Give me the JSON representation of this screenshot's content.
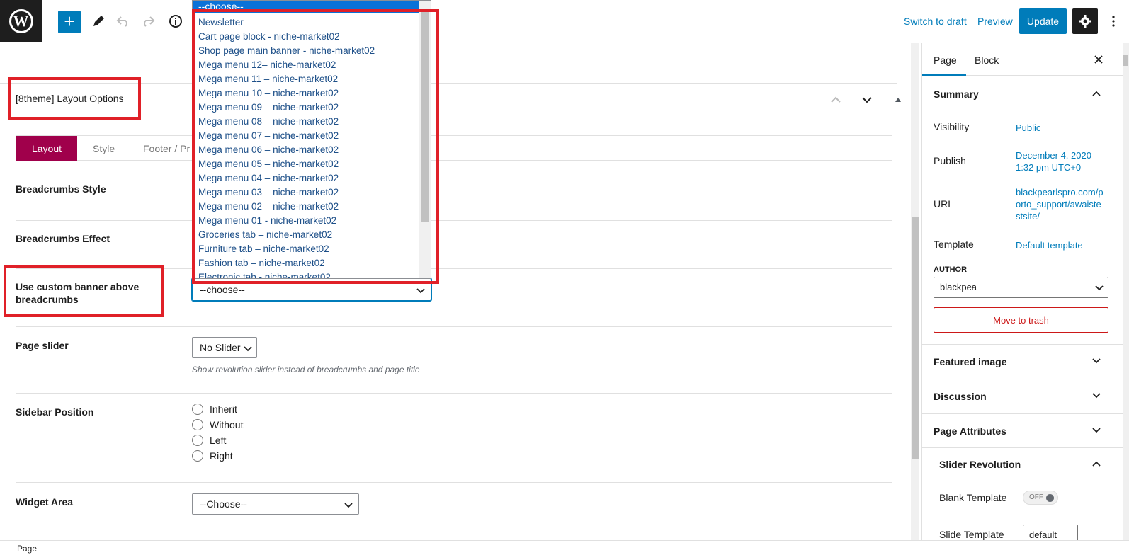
{
  "toolbar": {
    "switch_to_draft": "Switch to draft",
    "preview": "Preview",
    "update": "Update",
    "add_symbol": "+"
  },
  "metabox": {
    "title": "[8theme] Layout Options",
    "tabs": [
      "Layout",
      "Style",
      "Footer / Pr"
    ],
    "rows": {
      "breadcrumbs_style": "Breadcrumbs Style",
      "breadcrumbs_effect": "Breadcrumbs Effect",
      "custom_banner": "Use custom banner above breadcrumbs",
      "page_slider": "Page slider",
      "sidebar_position": "Sidebar Position",
      "widget_area": "Widget Area"
    },
    "custom_banner_value": "--choose--",
    "page_slider_value": "No Slider",
    "page_slider_help": "Show revolution slider instead of breadcrumbs and page title",
    "sidebar_options": [
      "Inherit",
      "Without",
      "Left",
      "Right"
    ],
    "widget_area_value": "--Choose--"
  },
  "dropdown": {
    "selected": "--choose--",
    "items": [
      "Newsletter",
      "Cart page block - niche-market02",
      "Shop page main banner - niche-market02",
      "Mega menu 12– niche-market02",
      "Mega menu 11 – niche-market02",
      "Mega menu 10 – niche-market02",
      "Mega menu 09 – niche-market02",
      "Mega menu 08 – niche-market02",
      "Mega menu 07 – niche-market02",
      "Mega menu 06 – niche-market02",
      "Mega menu 05 – niche-market02",
      "Mega menu 04 – niche-market02",
      "Mega menu 03 – niche-market02",
      "Mega menu 02 – niche-market02",
      "Mega menu 01 - niche-market02",
      "Groceries tab – niche-market02",
      "Furniture tab – niche-market02",
      "Fashion tab – niche-market02",
      "Electronic tab - niche-market02"
    ]
  },
  "sidebar": {
    "tabs": {
      "page": "Page",
      "block": "Block"
    },
    "summary_title": "Summary",
    "visibility_label": "Visibility",
    "visibility_value": "Public",
    "publish_label": "Publish",
    "publish_value_line1": "December 4, 2020",
    "publish_value_line2": "1:32 pm UTC+0",
    "url_label": "URL",
    "url_line1": "blackpearlspro.com/p",
    "url_line2": "orto_support/awaiste",
    "url_line3": "stsite/",
    "template_label": "Template",
    "template_value": "Default template",
    "author_label": "AUTHOR",
    "author_value": "blackpea",
    "trash_label": "Move to trash",
    "featured_image": "Featured image",
    "discussion": "Discussion",
    "page_attributes": "Page Attributes",
    "slider_revolution": "Slider Revolution",
    "blank_template": "Blank Template",
    "toggle_state": "OFF",
    "slide_template_label": "Slide Template",
    "slide_template_value": "default"
  },
  "status": {
    "breadcrumb": "Page"
  },
  "colors": {
    "accent": "#007cba",
    "tab_active": "#a0004b",
    "highlight": "#e02028",
    "dark": "#1e1e1e"
  }
}
